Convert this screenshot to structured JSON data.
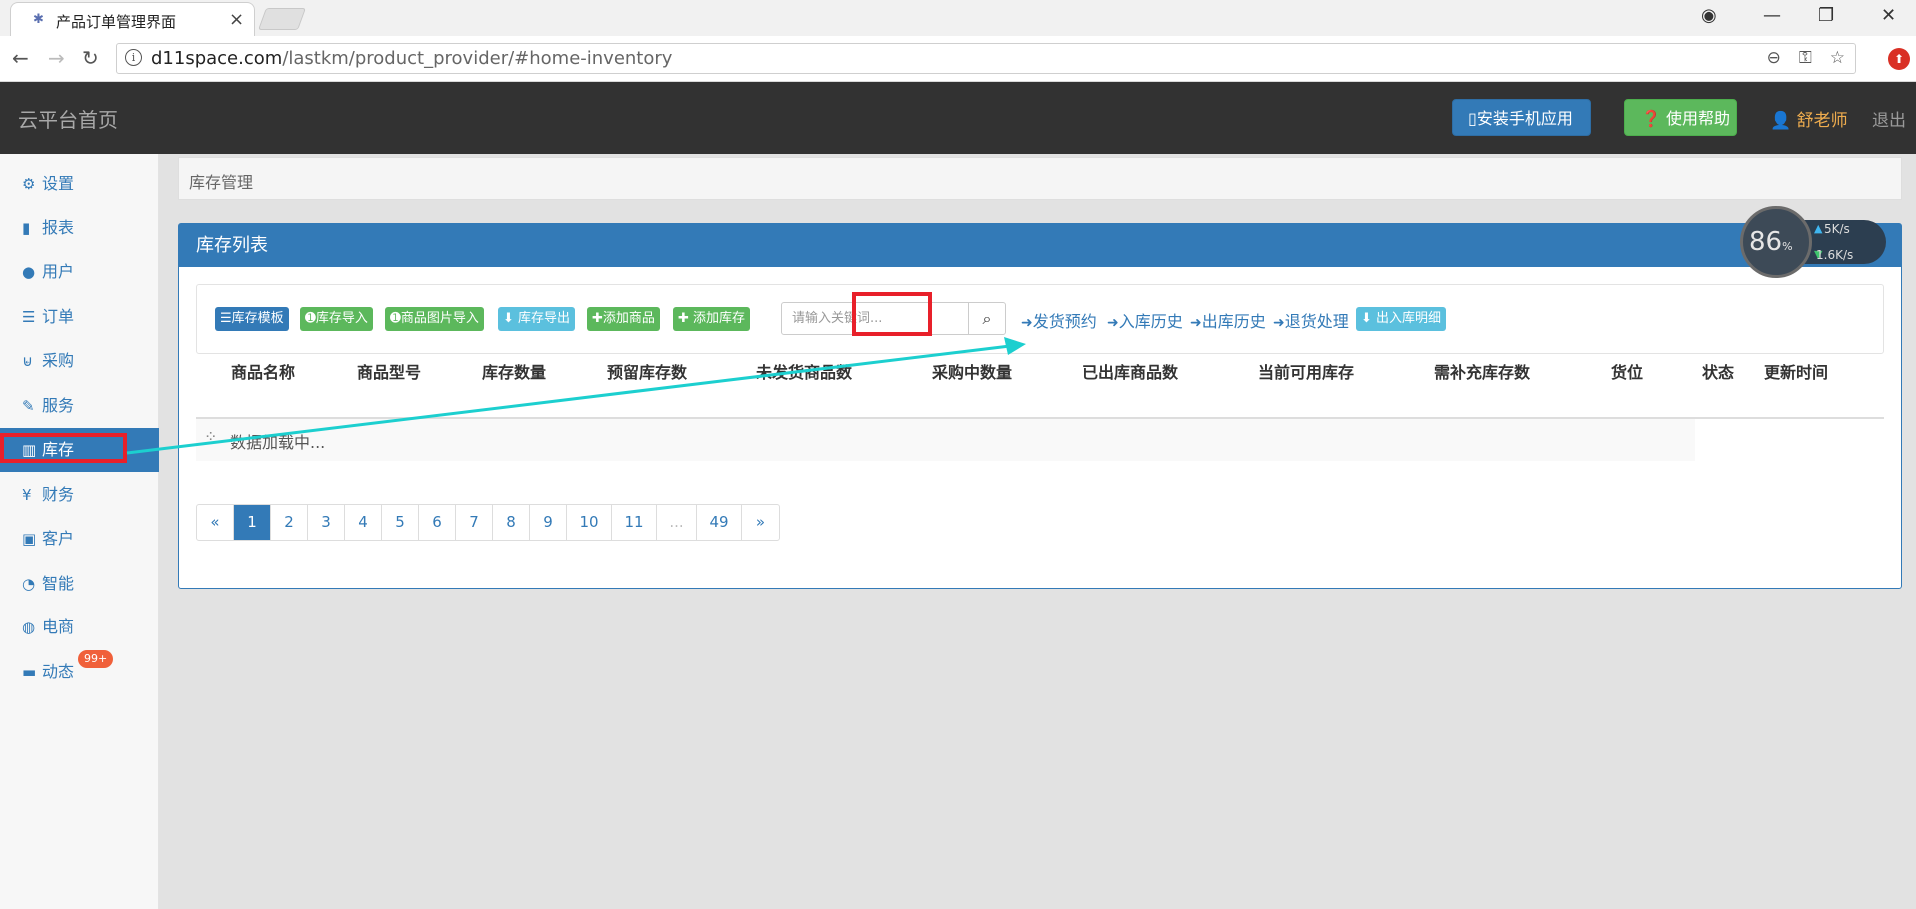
{
  "browser": {
    "tab_title": "产品订单管理界面",
    "url_host": "d11space.com",
    "url_path": "/lastkm/product_provider/#home-inventory"
  },
  "header": {
    "app_title": "云平台首页",
    "install_app": "安装手机应用",
    "help": "使用帮助",
    "user": "舒老师",
    "logout": "退出"
  },
  "sidebar": {
    "items": [
      {
        "label": "设置",
        "icon": "gear-icon"
      },
      {
        "label": "报表",
        "icon": "bar-chart-icon"
      },
      {
        "label": "用户",
        "icon": "user-icon"
      },
      {
        "label": "订单",
        "icon": "list-icon"
      },
      {
        "label": "采购",
        "icon": "cart-icon"
      },
      {
        "label": "服务",
        "icon": "wrench-icon"
      },
      {
        "label": "库存",
        "icon": "barcode-icon"
      },
      {
        "label": "财务",
        "icon": "yen-icon"
      },
      {
        "label": "客户",
        "icon": "briefcase-icon"
      },
      {
        "label": "智能",
        "icon": "dashboard-icon"
      },
      {
        "label": "电商",
        "icon": "globe-icon"
      },
      {
        "label": "动态",
        "icon": "comment-icon"
      }
    ],
    "badge": "99+"
  },
  "breadcrumb": "库存管理",
  "panel": {
    "title": "库存列表",
    "buttons": {
      "template": "库存模板",
      "import": "库存导入",
      "image_import": "商品图片导入",
      "export": "库存导出",
      "add_product": "添加商品",
      "add_stock": "添加库存",
      "detail": "出入库明细"
    },
    "search_placeholder": "请输入关键词...",
    "links": {
      "ship_reserve": "发货预约",
      "inbound_history": "入库历史",
      "outbound_history": "出库历史",
      "returns": "退货处理"
    },
    "columns": [
      "商品名称",
      "商品型号",
      "库存数量",
      "预留库存数",
      "未发货商品数",
      "采购中数量",
      "已出库商品数",
      "当前可用库存",
      "需补充库存数",
      "货位",
      "状态",
      "更新时间"
    ],
    "loading": "数据加载中..."
  },
  "pagination": [
    "«",
    "1",
    "2",
    "3",
    "4",
    "5",
    "6",
    "7",
    "8",
    "9",
    "10",
    "11",
    "...",
    "49",
    "»"
  ],
  "pagination_active": "1",
  "net_widget": {
    "percent": "86",
    "percent_sign": "%",
    "up": "5K/s",
    "down": "1.6K/s"
  },
  "colors": {
    "primary": "#337ab7",
    "success": "#5cb85c",
    "info": "#5bc0de",
    "highlight": "#e8202a",
    "arrow": "#1ccfcf",
    "header_bg": "#323232"
  }
}
